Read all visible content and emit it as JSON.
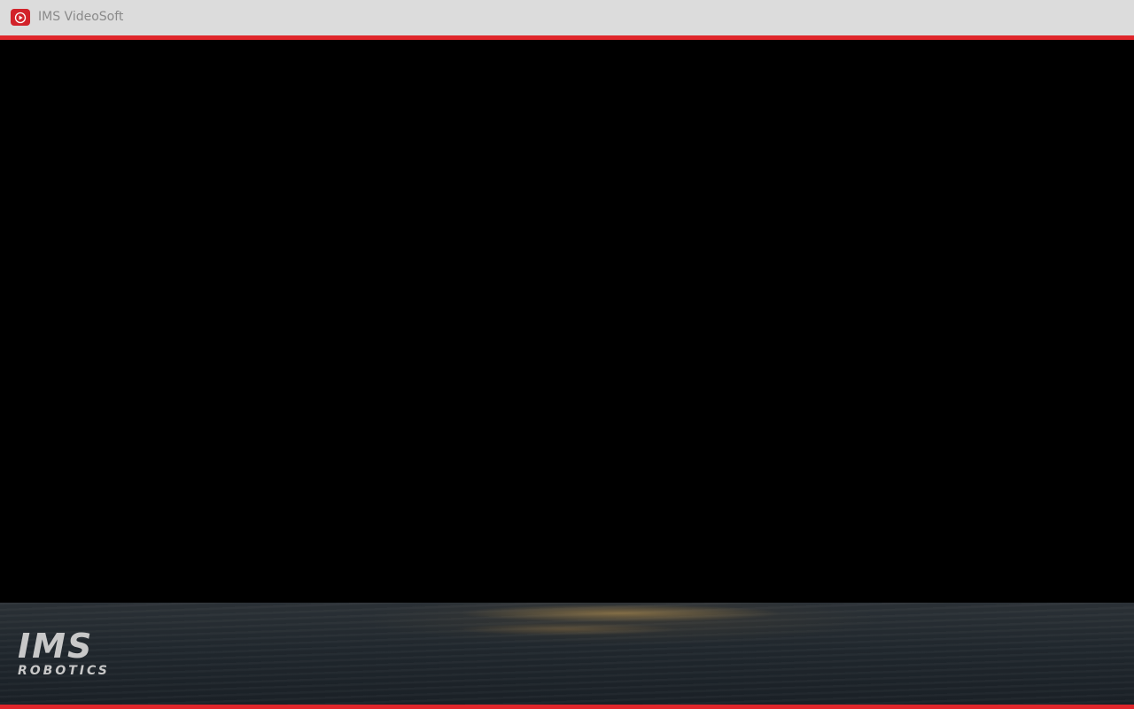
{
  "window": {
    "title": "IMS VideoSoft",
    "icon": "play-circle-icon"
  },
  "colors": {
    "accent": "#e0262b",
    "title_bar_bg": "#dcdcdc",
    "video_bg": "#000000"
  },
  "footer": {
    "logo_main": "IMS",
    "logo_sub": "ROBOTICS"
  }
}
